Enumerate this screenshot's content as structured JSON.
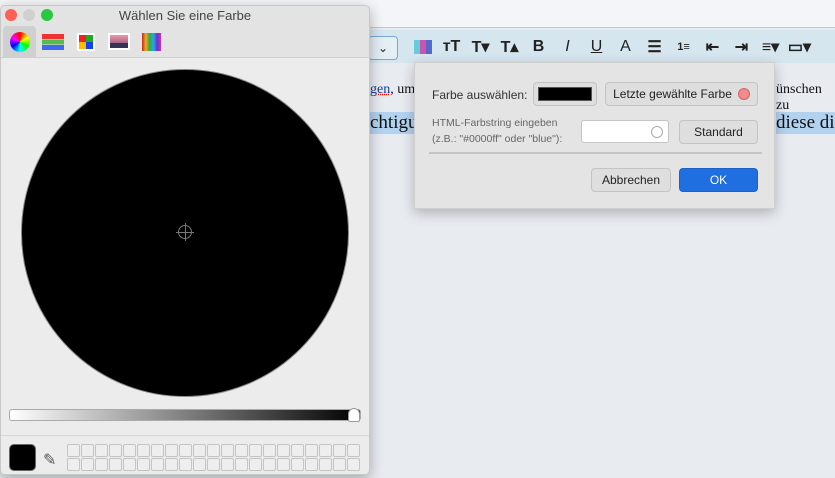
{
  "color_panel": {
    "title": "Wählen Sie eine Farbe",
    "modes": [
      "color-wheel",
      "color-sliders",
      "color-palettes",
      "image-palettes",
      "pencils"
    ],
    "brightness_percent": 0,
    "current_color": "#000000",
    "swatch_rows": 2,
    "swatch_cols": 21
  },
  "editor": {
    "line1_left": "gen",
    "line1_mid": ", um",
    "line1_right": "ünschen zu",
    "line2_left": "chtigun",
    "line2_right": "diese din"
  },
  "dialog": {
    "choose_label": "Farbe auswählen:",
    "choose_color": "#000000",
    "recent_label": "Letzte gewählte Farbe",
    "recent_color": "#f08c8c",
    "html_label_1": "HTML-Farbstring eingeben",
    "html_label_2": "(z.B.: \"#0000ff\" oder \"blue\"):",
    "html_value": "",
    "standard_label": "Standard",
    "cancel_label": "Abbrechen",
    "ok_label": "OK"
  }
}
